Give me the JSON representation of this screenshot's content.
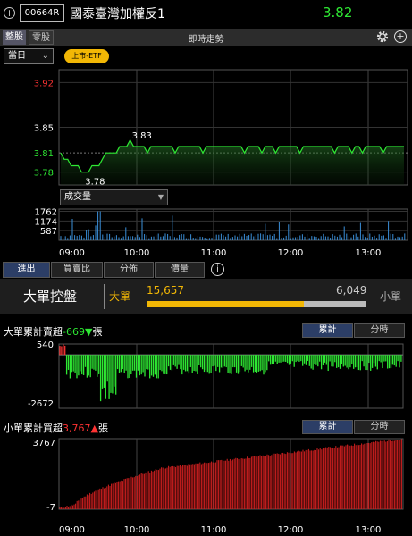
{
  "header": {
    "code": "00664R",
    "name": "國泰臺灣加權反1",
    "price": "3.82"
  },
  "tabs": {
    "whole": "整股",
    "odd": "零股",
    "center_title": "即時走勢"
  },
  "controls": {
    "period": "當日",
    "badge": "上市-ETF",
    "volume_select": "成交量"
  },
  "subtabs": [
    "進出",
    "買賣比",
    "分佈",
    "價量"
  ],
  "big_panel": {
    "title": "大單控盤",
    "big_label": "大單",
    "big_value": "15,657",
    "small_value": "6,049",
    "small_label": "小單",
    "big_ratio": 0.72
  },
  "large_section": {
    "prefix": "大單累計賣超",
    "value": "-669",
    "arrow": "▼",
    "unit": "張",
    "toggle_cum": "累計",
    "toggle_time": "分時"
  },
  "small_section": {
    "prefix": "小單累計買超",
    "value": "3,767",
    "arrow": "▲",
    "unit": "張",
    "toggle_cum": "累計",
    "toggle_time": "分時"
  },
  "colors": {
    "up": "#ff3333",
    "down": "#2ee833",
    "accent": "#f2b705"
  },
  "chart_data": [
    {
      "type": "line",
      "name": "price",
      "y_ticks": [
        "3.92",
        "3.85",
        "3.81",
        "3.78"
      ],
      "x_ticks": [
        "09:00",
        "10:00",
        "11:00",
        "12:00",
        "13:00"
      ],
      "annotations": [
        {
          "text": "3.83"
        },
        {
          "text": "3.78"
        }
      ],
      "points": [
        3.81,
        3.8,
        3.8,
        3.79,
        3.79,
        3.79,
        3.78,
        3.78,
        3.78,
        3.79,
        3.79,
        3.79,
        3.8,
        3.81,
        3.81,
        3.81,
        3.81,
        3.82,
        3.82,
        3.82,
        3.83,
        3.82,
        3.82,
        3.82,
        3.82,
        3.81,
        3.82,
        3.82,
        3.82,
        3.82,
        3.82,
        3.82,
        3.82,
        3.81,
        3.82,
        3.82,
        3.82,
        3.82,
        3.82,
        3.82,
        3.82,
        3.81,
        3.82,
        3.82,
        3.82,
        3.82,
        3.82,
        3.82,
        3.82,
        3.82,
        3.82,
        3.82,
        3.82,
        3.81,
        3.82,
        3.82,
        3.82,
        3.82,
        3.81,
        3.82,
        3.82,
        3.82,
        3.81,
        3.82,
        3.82,
        3.82,
        3.82,
        3.82,
        3.82,
        3.81,
        3.82,
        3.82,
        3.82,
        3.82,
        3.82,
        3.82,
        3.82,
        3.82,
        3.82,
        3.81,
        3.82,
        3.82,
        3.82,
        3.82,
        3.81,
        3.82,
        3.82,
        3.81,
        3.82,
        3.82,
        3.82,
        3.82,
        3.82,
        3.81,
        3.82,
        3.82,
        3.82,
        3.82,
        3.82,
        3.82
      ],
      "ylim": [
        3.76,
        3.94
      ]
    },
    {
      "type": "bar",
      "name": "成交量",
      "y_ticks": [
        "1762",
        "1174",
        "587"
      ],
      "ylim": [
        0,
        1900
      ]
    },
    {
      "type": "bar",
      "name": "大單累計",
      "y_ticks": [
        "540",
        "-2672"
      ],
      "ylim": [
        -2672,
        540
      ]
    },
    {
      "type": "bar",
      "name": "小單累計",
      "y_ticks": [
        "3767",
        "-7"
      ],
      "x_ticks": [
        "09:00",
        "10:00",
        "11:00",
        "12:00",
        "13:00"
      ],
      "ylim": [
        -7,
        3767
      ]
    }
  ]
}
